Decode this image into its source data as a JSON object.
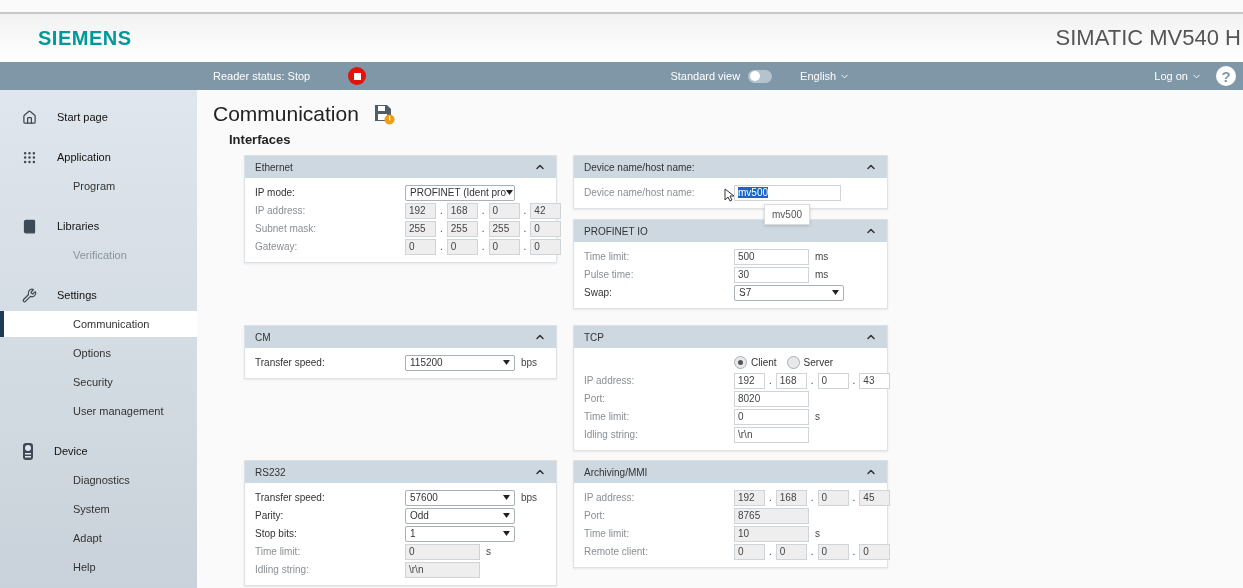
{
  "header": {
    "logo": "SIEMENS",
    "product": "SIMATIC MV540 H"
  },
  "navbar": {
    "status_label": "Reader status: Stop",
    "reader_running": false,
    "view_label": "Standard view",
    "standard_view_on": false,
    "language": "English",
    "logon": "Log on",
    "help": "?"
  },
  "sidebar": {
    "items": [
      {
        "label": "Start page",
        "kind": "home",
        "selected": false
      },
      {
        "label": "Application",
        "kind": "grid",
        "selected": false,
        "children": [
          {
            "label": "Program",
            "selected": false,
            "disabled": false
          }
        ]
      },
      {
        "label": "Libraries",
        "kind": "book",
        "selected": false,
        "children": [
          {
            "label": "Verification",
            "selected": false,
            "disabled": true
          }
        ]
      },
      {
        "label": "Settings",
        "kind": "wrench",
        "selected": false,
        "children": [
          {
            "label": "Communication",
            "selected": true,
            "disabled": false
          },
          {
            "label": "Options",
            "selected": false,
            "disabled": false
          },
          {
            "label": "Security",
            "selected": false,
            "disabled": false
          },
          {
            "label": "User management",
            "selected": false,
            "disabled": false
          }
        ]
      },
      {
        "label": "Device",
        "kind": "device",
        "selected": false,
        "children": [
          {
            "label": "Diagnostics",
            "selected": false,
            "disabled": false
          },
          {
            "label": "System",
            "selected": false,
            "disabled": false
          },
          {
            "label": "Adapt",
            "selected": false,
            "disabled": false
          },
          {
            "label": "Help",
            "selected": false,
            "disabled": false
          }
        ]
      }
    ]
  },
  "page": {
    "title": "Communication",
    "unsaved": true,
    "section": "Interfaces"
  },
  "panel_rows": [
    {
      "left": [
        {
          "title": "Ethernet",
          "expanded": true,
          "fields": [
            {
              "kind": "select",
              "label": "IP mode:",
              "value": "PROFINET (Ident pro",
              "disabled": false
            },
            {
              "kind": "ip",
              "label": "IP address:",
              "octets": [
                "192",
                "168",
                "0",
                "42"
              ],
              "separator": ".",
              "disabled": true
            },
            {
              "kind": "ip",
              "label": "Subnet mask:",
              "octets": [
                "255",
                "255",
                "255",
                "0"
              ],
              "separator": ".",
              "disabled": true
            },
            {
              "kind": "ip",
              "label": "Gateway:",
              "octets": [
                "0",
                "0",
                "0",
                "0"
              ],
              "separator": ".",
              "disabled": true
            }
          ]
        }
      ],
      "right": [
        {
          "title": "Device name/host name:",
          "expanded": true,
          "fields": [
            {
              "kind": "text",
              "label": "Device name/host name:",
              "value": "mv500",
              "disabled": false,
              "text_selected": true,
              "suggestion": "mv500"
            }
          ]
        },
        {
          "title": "PROFINET IO",
          "expanded": true,
          "fields": [
            {
              "kind": "text",
              "label": "Time limit:",
              "value": "500",
              "unit": "ms",
              "disabled": false
            },
            {
              "kind": "text",
              "label": "Pulse time:",
              "value": "30",
              "unit": "ms",
              "disabled": false
            },
            {
              "kind": "select",
              "label": "Swap:",
              "value": "S7",
              "disabled": false
            }
          ]
        }
      ]
    },
    {
      "left": [
        {
          "title": "CM",
          "expanded": true,
          "fields": [
            {
              "kind": "select",
              "label": "Transfer speed:",
              "value": "115200",
              "unit": "bps",
              "disabled": false
            }
          ]
        }
      ],
      "right": [
        {
          "title": "TCP",
          "expanded": true,
          "fields": [
            {
              "kind": "radio",
              "options": [
                {
                  "label": "Client",
                  "selected": true
                },
                {
                  "label": "Server",
                  "selected": false
                }
              ]
            },
            {
              "kind": "ip",
              "label": "IP address:",
              "octets": [
                "192",
                "168",
                "0",
                "43"
              ],
              "separator": ".",
              "disabled": false
            },
            {
              "kind": "text",
              "label": "Port:",
              "value": "8020",
              "disabled": false
            },
            {
              "kind": "text",
              "label": "Time limit:",
              "value": "0",
              "unit": "s",
              "disabled": false
            },
            {
              "kind": "text",
              "label": "Idling string:",
              "value": "\\r\\n",
              "disabled": false
            }
          ]
        }
      ]
    },
    {
      "left": [
        {
          "title": "RS232",
          "expanded": true,
          "fields": [
            {
              "kind": "select",
              "label": "Transfer speed:",
              "value": "57600",
              "unit": "bps",
              "disabled": false
            },
            {
              "kind": "select",
              "label": "Parity:",
              "value": "Odd",
              "disabled": false
            },
            {
              "kind": "select",
              "label": "Stop bits:",
              "value": "1",
              "disabled": false
            },
            {
              "kind": "text",
              "label": "Time limit:",
              "value": "0",
              "unit": "s",
              "disabled": true
            },
            {
              "kind": "text",
              "label": "Idling string:",
              "value": "\\r\\n",
              "disabled": true
            }
          ]
        }
      ],
      "right": [
        {
          "title": "Archiving/MMI",
          "expanded": true,
          "fields": [
            {
              "kind": "ip",
              "label": "IP address:",
              "octets": [
                "192",
                "168",
                "0",
                "45"
              ],
              "separator": ".",
              "disabled": true
            },
            {
              "kind": "text",
              "label": "Port:",
              "value": "8765",
              "disabled": true
            },
            {
              "kind": "text",
              "label": "Time limit:",
              "value": "10",
              "unit": "s",
              "disabled": true
            },
            {
              "kind": "ip",
              "label": "Remote client:",
              "octets": [
                "0",
                "0",
                "0",
                "0"
              ],
              "separator": ".",
              "disabled": true
            }
          ]
        }
      ]
    }
  ]
}
